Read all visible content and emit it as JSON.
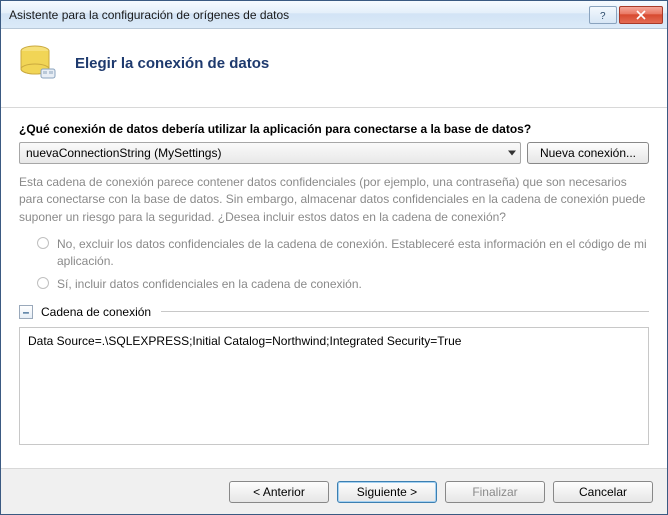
{
  "window": {
    "title": "Asistente para la configuración de orígenes de datos"
  },
  "header": {
    "title": "Elegir la conexión de datos"
  },
  "prompt": "¿Qué conexión de datos debería utilizar la aplicación para conectarse a la base de datos?",
  "combo": {
    "selected": "nuevaConnectionString (MySettings)"
  },
  "buttons": {
    "new_connection": "Nueva conexión...",
    "back": "< Anterior",
    "next": "Siguiente >",
    "finish": "Finalizar",
    "cancel": "Cancelar"
  },
  "info_text": "Esta cadena de conexión parece contener datos confidenciales (por ejemplo, una contraseña) que son necesarios para conectarse con la base de datos. Sin embargo, almacenar datos confidenciales en la cadena de conexión puede suponer un riesgo para la seguridad. ¿Desea incluir estos datos en la cadena de conexión?",
  "radios": {
    "exclude": "No, excluir los datos confidenciales de la cadena de conexión. Estableceré esta información en el código de mi aplicación.",
    "include": "Sí, incluir datos confidenciales en la cadena de conexión."
  },
  "section": {
    "label": "Cadena de conexión",
    "expander_symbol": "–"
  },
  "connection_string": "Data Source=.\\SQLEXPRESS;Initial Catalog=Northwind;Integrated Security=True"
}
